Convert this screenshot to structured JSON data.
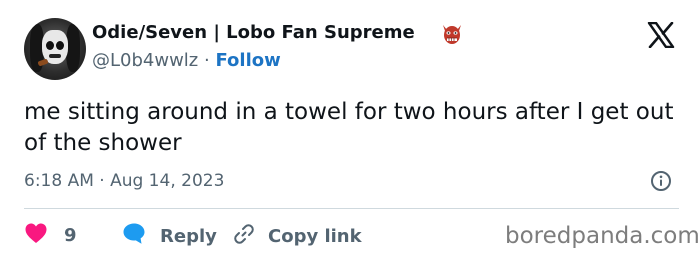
{
  "author": {
    "display_name": "Odie/Seven | Lobo Fan Supreme",
    "handle": "@L0b4wwlz",
    "separator": "·",
    "follow_label": "Follow",
    "badge_icon": "demon-mask-icon"
  },
  "platform_icon": "x-logo-icon",
  "tweet": {
    "text": "me sitting around in a towel for two hours after I get out of the shower",
    "timestamp": "6:18 AM · Aug 14, 2023"
  },
  "actions": {
    "like_count": "9",
    "reply_label": "Reply",
    "copy_link_label": "Copy link"
  },
  "watermark": "boredpanda.com",
  "colors": {
    "like": "#f91880",
    "reply": "#1d9bf0",
    "follow": "#1d74c4",
    "muted": "#536471",
    "text": "#0f1419"
  }
}
